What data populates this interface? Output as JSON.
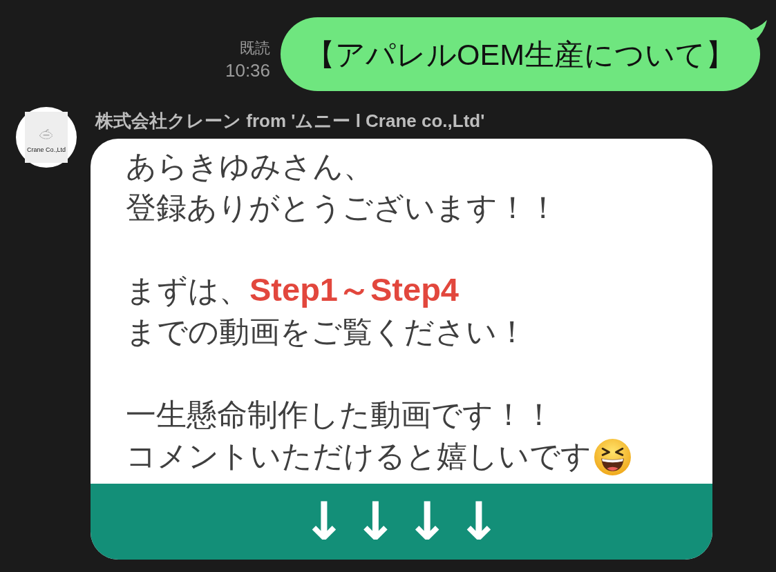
{
  "sent_message": {
    "read_label": "既読",
    "time": "10:36",
    "text": "【アパレルOEM生産について】"
  },
  "received_message": {
    "avatar": {
      "logo_text": "Crane Co.,Ltd"
    },
    "sender": "株式会社クレーン from 'ムニー l Crane co.,Ltd'",
    "paragraphs": [
      [
        "あらきゆみさん、",
        "登録ありがとうございます！！"
      ],
      [
        "まずは、**Step1～Step4**",
        "までの動画をご覧ください！"
      ],
      [
        "一生懸命制作した動画です！！",
        "コメントいただけると嬉しいです"
      ]
    ],
    "button": {
      "label": "↓↓↓↓"
    }
  }
}
